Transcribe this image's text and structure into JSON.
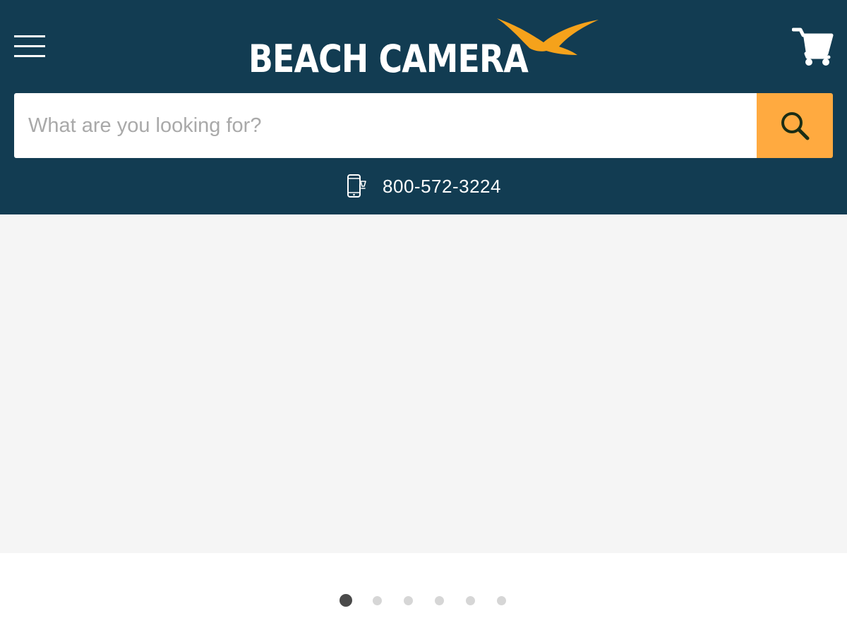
{
  "header": {
    "brand_name": "BEACH CAMERA",
    "background_color": "#123c52",
    "menu_icon": "hamburger-menu-icon",
    "cart_icon": "shopping-cart-icon"
  },
  "search": {
    "placeholder": "What are you looking for?",
    "value": "",
    "button_icon": "search-icon",
    "button_color": "#ffaa40"
  },
  "contact": {
    "phone_icon": "mobile-phone-icon",
    "phone_number": "800-572-3224"
  },
  "slideshow": {
    "slide_count": 6,
    "active_index": 0
  }
}
